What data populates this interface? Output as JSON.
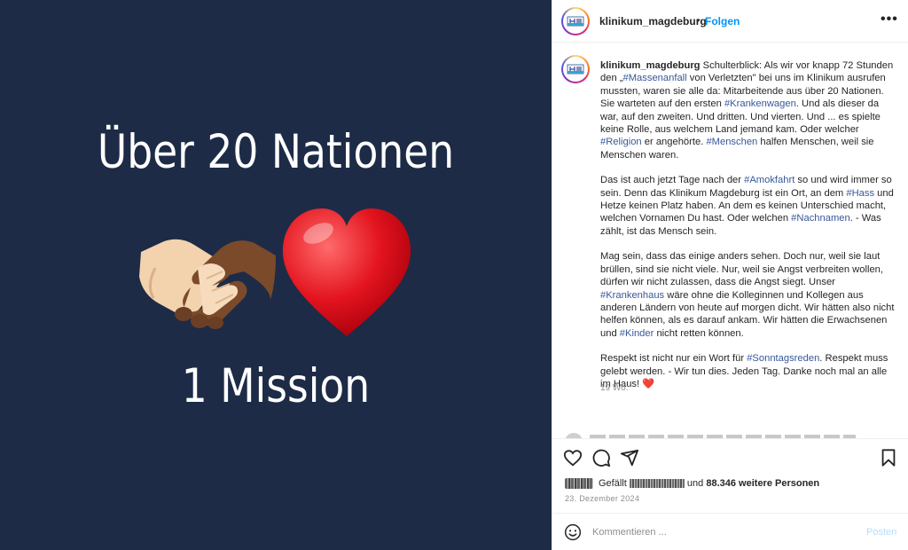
{
  "image": {
    "headline": "Über 20 Nationen",
    "mission": "1 Mission",
    "background_color": "#1d2b47",
    "emoji": [
      "handshake",
      "red-heart"
    ]
  },
  "post": {
    "username": "klinikum_magdeburg",
    "dot": "•",
    "follow_label": "Folgen",
    "more_icon": "more-horizontal-icon",
    "caption": {
      "username": "klinikum_magdeburg",
      "paragraphs": [
        [
          {
            "t": " Schulterblick: Als wir vor knapp 72 Stunden den „"
          },
          {
            "tag": "#Massenanfall"
          },
          {
            "t": " von Verletzten\" bei uns im Klinikum ausrufen mussten, waren sie alle da: Mitarbeitende aus über 20 Nationen. Sie warteten auf den ersten "
          },
          {
            "tag": "#Krankenwagen"
          },
          {
            "t": ". Und als dieser da war, auf den zweiten. Und dritten. Und vierten. Und ... es spielte keine Rolle, aus welchem Land jemand kam. Oder welcher "
          },
          {
            "tag": "#Religion"
          },
          {
            "t": " er angehörte. "
          },
          {
            "tag": "#Menschen"
          },
          {
            "t": " halfen Menschen, weil sie Menschen waren."
          }
        ],
        [
          {
            "t": "Das ist auch jetzt Tage nach der "
          },
          {
            "tag": "#Amokfahrt"
          },
          {
            "t": " so und wird immer so sein. Denn das Klinikum Magdeburg ist ein Ort, an dem "
          },
          {
            "tag": "#Hass"
          },
          {
            "t": " und Hetze keinen Platz haben. An dem es keinen Unterschied macht, welchen Vornamen Du hast. Oder welchen "
          },
          {
            "tag": "#Nachnamen"
          },
          {
            "t": ". - Was zählt, ist das Mensch sein."
          }
        ],
        [
          {
            "t": "Mag sein, dass das einige anders sehen. Doch nur, weil sie laut brüllen, sind sie nicht viele. Nur, weil sie Angst verbreiten wollen, dürfen wir nicht zulassen, dass die Angst siegt. Unser "
          },
          {
            "tag": "#Krankenhaus"
          },
          {
            "t": " wäre ohne die Kolleginnen und Kollegen aus anderen Ländern von heute auf morgen dicht. Wir hätten also nicht helfen können, als es darauf ankam. Wir hätten die Erwachsenen und "
          },
          {
            "tag": "#Kinder"
          },
          {
            "t": " nicht retten können."
          }
        ],
        [
          {
            "t": "Respekt ist nicht nur ein Wort für "
          },
          {
            "tag": "#Sonntagsreden"
          },
          {
            "t": ". Respekt muss gelebt werden. - Wir tun dies. Jeden Tag. Danke noch mal an alle im Haus! "
          },
          {
            "heart": "❤️"
          }
        ]
      ],
      "time_ago": "19 Wo."
    },
    "actions": {
      "like_icon": "heart-outline-icon",
      "comment_icon": "comment-icon",
      "share_icon": "send-icon",
      "save_icon": "bookmark-icon"
    },
    "likes": {
      "prefix": "Gefällt",
      "middle": "und",
      "count_text": "88.346 weitere Personen"
    },
    "date": "23. Dezember 2024",
    "comment": {
      "placeholder": "Kommentieren ...",
      "post_label": "Posten",
      "emoji_icon": "smiley-icon"
    },
    "colors": {
      "link": "#385898",
      "follow": "#0095f6",
      "muted": "#8e8e8e"
    }
  }
}
